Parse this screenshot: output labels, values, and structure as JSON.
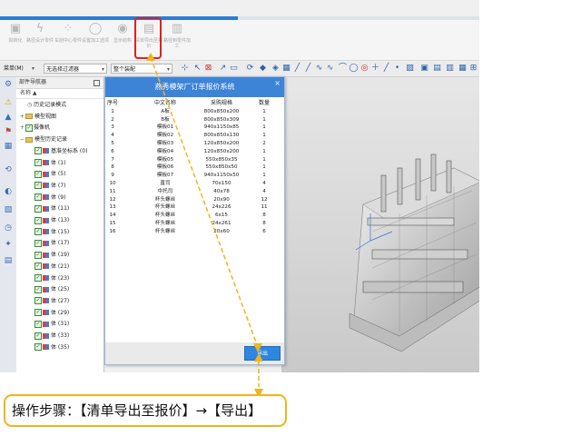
{
  "ribbon": {
    "buttons": [
      {
        "label": "拟转化",
        "icon": "cube-icon"
      },
      {
        "label": "路径设计零件",
        "icon": "lightning-icon"
      },
      {
        "label": "车削中心零件",
        "icon": "dots-icon"
      },
      {
        "label": "设置加工选项",
        "icon": "circle-icon"
      },
      {
        "label": "显示结构",
        "icon": "eye-icon"
      },
      {
        "label": "清单导出至报价",
        "icon": "document-icon"
      },
      {
        "label": "路径到零件加工",
        "icon": "save-icon"
      }
    ]
  },
  "toolbar": {
    "menu_label": "菜单(M)",
    "filter_value": "无选择过滤器",
    "assembly_value": "整个装配"
  },
  "navigator": {
    "title": "部件导航器",
    "column_header": "名称",
    "items": [
      {
        "label": "历史记录模式",
        "kind": "clock"
      },
      {
        "label": "模型视图",
        "kind": "folder-plus"
      },
      {
        "label": "摄像机",
        "kind": "check-plus"
      },
      {
        "label": "模型历史记录",
        "kind": "folder-minus"
      },
      {
        "label": "基准坐标系 (0)",
        "kind": "body"
      },
      {
        "label": "体 (1)",
        "kind": "body"
      },
      {
        "label": "体 (5)",
        "kind": "body"
      },
      {
        "label": "体 (7)",
        "kind": "body"
      },
      {
        "label": "体 (9)",
        "kind": "body"
      },
      {
        "label": "体 (11)",
        "kind": "body"
      },
      {
        "label": "体 (13)",
        "kind": "body"
      },
      {
        "label": "体 (15)",
        "kind": "body"
      },
      {
        "label": "体 (17)",
        "kind": "body"
      },
      {
        "label": "体 (19)",
        "kind": "body"
      },
      {
        "label": "体 (21)",
        "kind": "body"
      },
      {
        "label": "体 (23)",
        "kind": "body"
      },
      {
        "label": "体 (25)",
        "kind": "body"
      },
      {
        "label": "体 (27)",
        "kind": "body"
      },
      {
        "label": "体 (29)",
        "kind": "body"
      },
      {
        "label": "体 (31)",
        "kind": "body"
      },
      {
        "label": "体 (33)",
        "kind": "body"
      },
      {
        "label": "体 (35)",
        "kind": "body"
      }
    ]
  },
  "dialog": {
    "title": "燕秀模架厂订单报价系统",
    "close": "×",
    "headers": [
      "序号",
      "中文名称",
      "采购规格",
      "数量"
    ],
    "rows": [
      [
        "1",
        "A板",
        "800x850x200",
        "1"
      ],
      [
        "2",
        "B板",
        "800x850x309",
        "1"
      ],
      [
        "3",
        "模板01",
        "940x1150x85",
        "1"
      ],
      [
        "4",
        "模板02",
        "800x850x130",
        "1"
      ],
      [
        "5",
        "模板03",
        "120x850x200",
        "2"
      ],
      [
        "6",
        "模板04",
        "120x850x200",
        "1"
      ],
      [
        "7",
        "模板05",
        "550x850x35",
        "1"
      ],
      [
        "8",
        "模板06",
        "550x850x50",
        "1"
      ],
      [
        "9",
        "模板07",
        "940x1150x50",
        "1"
      ],
      [
        "10",
        "直司",
        "70x150",
        "4"
      ],
      [
        "11",
        "中托司",
        "40x78",
        "4"
      ],
      [
        "12",
        "杯头螺丝",
        "20x90",
        "12"
      ],
      [
        "13",
        "杯头螺丝",
        "24x226",
        "11"
      ],
      [
        "14",
        "杯头螺丝",
        "6x15",
        "8"
      ],
      [
        "15",
        "杯头螺丝",
        "24x261",
        "8"
      ],
      [
        "16",
        "杯头螺丝",
        "20x60",
        "6"
      ]
    ],
    "export_label": "导出"
  },
  "callout": {
    "text": "操作步骤：【清单导出至报价】→【导出】"
  },
  "colors": {
    "dialog_title_bg": "#3d84d6",
    "highlight_red": "#e02020",
    "callout_border": "#f0b41c",
    "arrow": "#f0b41c"
  }
}
